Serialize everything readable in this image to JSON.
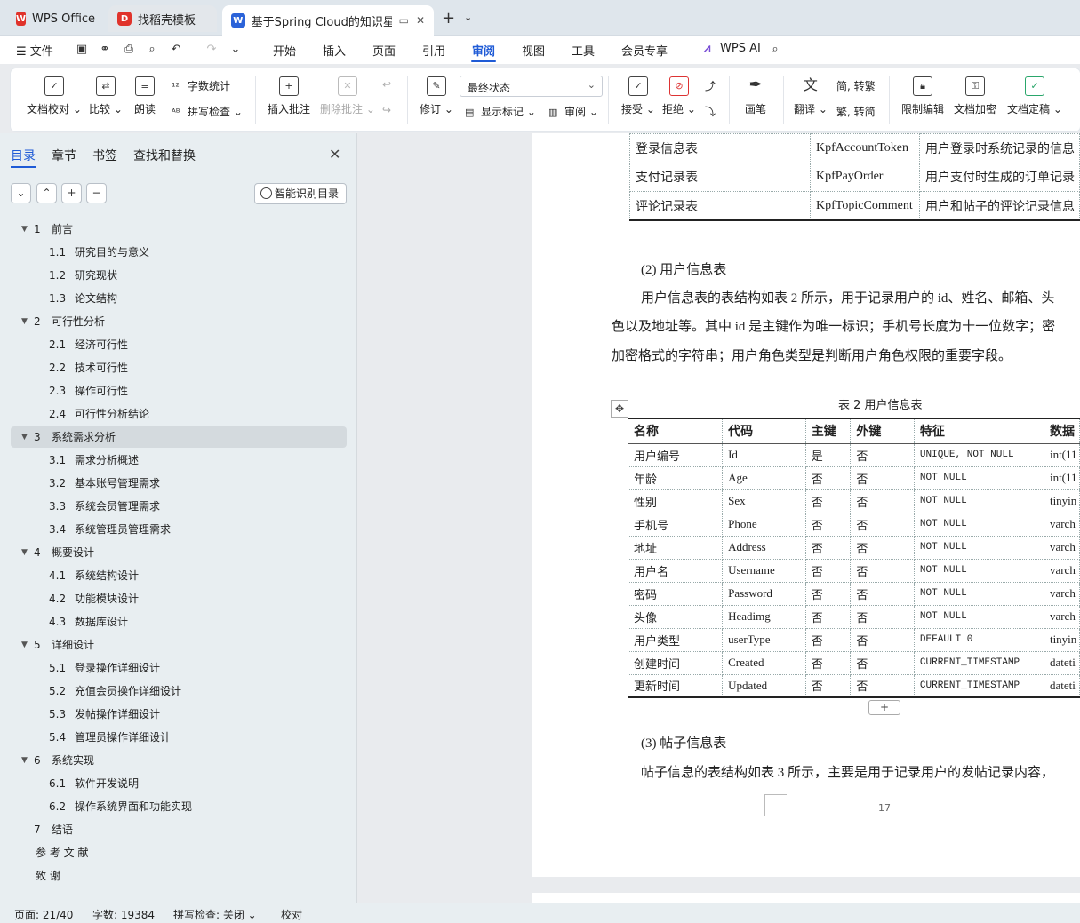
{
  "titlebar": {
    "tabs": [
      {
        "label": "WPS Office",
        "icon": "wps-logo-icon",
        "color": "#e0332b"
      },
      {
        "label": "找稻壳模板",
        "icon": "docer-icon",
        "color": "#e0332b"
      },
      {
        "label": "基于Spring Cloud的知识星球",
        "icon": "wps-writer-icon",
        "color": "#2b63d9"
      }
    ],
    "new_tab": "+",
    "tab_list": "⌄"
  },
  "menubar": {
    "file": "文件",
    "items": [
      "开始",
      "插入",
      "页面",
      "引用",
      "审阅",
      "视图",
      "工具",
      "会员专享"
    ],
    "active": "审阅",
    "ai": "WPS AI"
  },
  "ribbon": {
    "doc_check": "文档校对",
    "compare": "比较",
    "read_aloud": "朗读",
    "word_count": "字数统计",
    "spell_check": "拼写检查",
    "insert_comment": "插入批注",
    "delete_comment": "删除批注",
    "track_changes": "修订",
    "status_value": "最终状态",
    "show_markup": "显示标记",
    "review_pane": "审阅",
    "accept": "接受",
    "reject": "拒绝",
    "pen": "画笔",
    "translate": "翻译",
    "to_traditional": "简, 转繁",
    "to_simplified": "繁, 转简",
    "restrict_edit": "限制编辑",
    "encrypt": "文档加密",
    "finalize": "文档定稿"
  },
  "panel": {
    "tabs": [
      "目录",
      "章节",
      "书签",
      "查找和替换"
    ],
    "active_tab": "目录",
    "smart_toc": "智能识别目录",
    "buttons": [
      "⌄",
      "⌃",
      "+",
      "−"
    ],
    "toc": [
      {
        "num": "1",
        "text": "前言",
        "level": 1,
        "expand": true
      },
      {
        "num": "1.1",
        "text": "研究目的与意义",
        "level": 2
      },
      {
        "num": "1.2",
        "text": "研究现状",
        "level": 2
      },
      {
        "num": "1.3",
        "text": "论文结构",
        "level": 2
      },
      {
        "num": "2",
        "text": "可行性分析",
        "level": 1,
        "expand": true
      },
      {
        "num": "2.1",
        "text": "经济可行性",
        "level": 2
      },
      {
        "num": "2.2",
        "text": "技术可行性",
        "level": 2
      },
      {
        "num": "2.3",
        "text": "操作可行性",
        "level": 2
      },
      {
        "num": "2.4",
        "text": "可行性分析结论",
        "level": 2
      },
      {
        "num": "3",
        "text": "系统需求分析",
        "level": 1,
        "expand": true,
        "selected": true
      },
      {
        "num": "3.1",
        "text": "需求分析概述",
        "level": 2
      },
      {
        "num": "3.2",
        "text": "基本账号管理需求",
        "level": 2
      },
      {
        "num": "3.3",
        "text": "系统会员管理需求",
        "level": 2
      },
      {
        "num": "3.4",
        "text": "系统管理员管理需求",
        "level": 2
      },
      {
        "num": "4",
        "text": "概要设计",
        "level": 1,
        "expand": true
      },
      {
        "num": "4.1",
        "text": "系统结构设计",
        "level": 2
      },
      {
        "num": "4.2",
        "text": "功能模块设计",
        "level": 2
      },
      {
        "num": "4.3",
        "text": "数据库设计",
        "level": 2
      },
      {
        "num": "5",
        "text": "详细设计",
        "level": 1,
        "expand": true
      },
      {
        "num": "5.1",
        "text": "登录操作详细设计",
        "level": 2
      },
      {
        "num": "5.2",
        "text": "充值会员操作详细设计",
        "level": 2
      },
      {
        "num": "5.3",
        "text": "发帖操作详细设计",
        "level": 2
      },
      {
        "num": "5.4",
        "text": "管理员操作详细设计",
        "level": 2
      },
      {
        "num": "6",
        "text": "系统实现",
        "level": 1,
        "expand": true
      },
      {
        "num": "6.1",
        "text": "软件开发说明",
        "level": 2
      },
      {
        "num": "6.2",
        "text": "操作系统界面和功能实现",
        "level": 2
      },
      {
        "num": "7",
        "text": "结语",
        "level": 1,
        "expand": false
      },
      {
        "num": "",
        "text": "参 考 文 献",
        "level": 1,
        "expand": false
      },
      {
        "num": "",
        "text": "致      谢",
        "level": 1,
        "expand": false
      }
    ]
  },
  "document": {
    "top_table": [
      [
        "登录信息表",
        "KpfAccountToken",
        "用户登录时系统记录的信息"
      ],
      [
        "支付记录表",
        "KpfPayOrder",
        "用户支付时生成的订单记录"
      ],
      [
        "评论记录表",
        "KpfTopicComment",
        "用户和帖子的评论记录信息"
      ]
    ],
    "heading2": "(2)   用户信息表",
    "para1_line1": "用户信息表的表结构如表 2 所示，用于记录用户的 id、姓名、邮箱、头",
    "para1_line2": "色以及地址等。其中 id 是主键作为唯一标识；手机号长度为十一位数字；密",
    "para1_line3": "加密格式的字符串；用户角色类型是判断用户角色权限的重要字段。",
    "table2_caption": "表 2  用户信息表",
    "table2_headers": [
      "名称",
      "代码",
      "主键",
      "外键",
      "特征",
      "数据"
    ],
    "table2_rows": [
      [
        "用户编号",
        "Id",
        "是",
        "否",
        "UNIQUE, NOT NULL",
        "int(11"
      ],
      [
        "年龄",
        "Age",
        "否",
        "否",
        "NOT NULL",
        "int(11"
      ],
      [
        "性别",
        "Sex",
        "否",
        "否",
        "NOT NULL",
        "tinyin"
      ],
      [
        "手机号",
        "Phone",
        "否",
        "否",
        "NOT NULL",
        "varch"
      ],
      [
        "地址",
        "Address",
        "否",
        "否",
        "NOT NULL",
        "varch"
      ],
      [
        "用户名",
        "Username",
        "否",
        "否",
        "NOT NULL",
        "varch"
      ],
      [
        "密码",
        "Password",
        "否",
        "否",
        "NOT NULL",
        "varch"
      ],
      [
        "头像",
        "Headimg",
        "否",
        "否",
        "NOT NULL",
        "varch"
      ],
      [
        "用户类型",
        "userType",
        "否",
        "否",
        "DEFAULT 0",
        "tinyin"
      ],
      [
        "创建时间",
        "Created",
        "否",
        "否",
        "CURRENT_TIMESTAMP",
        "dateti"
      ],
      [
        "更新时间",
        "Updated",
        "否",
        "否",
        "CURRENT_TIMESTAMP",
        "dateti"
      ]
    ],
    "add_row": "+",
    "heading3": "(3)   帖子信息表",
    "para2_line1": "帖子信息的表结构如表 3 所示，主要是用于记录用户的发帖记录内容，",
    "page_number": "17"
  },
  "statusbar": {
    "page": "页面: 21/40",
    "words": "字数: 19384",
    "spell": "拼写检查: 关闭",
    "proof": "校对"
  }
}
